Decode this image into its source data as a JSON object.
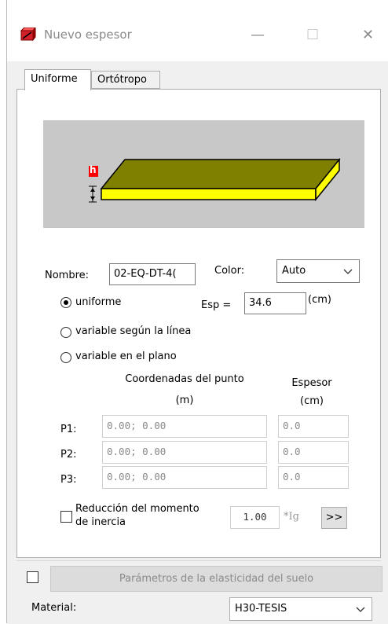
{
  "window": {
    "title": "Nuevo espesor",
    "min_glyph": "—",
    "max_glyph": "☐",
    "close_glyph": "✕"
  },
  "tabs": [
    {
      "label": "Uniforme",
      "active": true
    },
    {
      "label": "Ortótropo",
      "active": false
    }
  ],
  "preview": {
    "h_label": "h",
    "slab_color": "#808000",
    "edge_color": "#ffff00"
  },
  "form": {
    "nombre_label": "Nombre:",
    "nombre_value": "02-EQ-DT-4(",
    "color_label": "Color:",
    "color_value": "Auto",
    "radio_uniforme": "uniforme",
    "esp_label": "Esp =",
    "esp_value": "34.6",
    "esp_unit": "(cm)",
    "radio_linea": "variable según la línea",
    "radio_plano": "variable en el plano",
    "coord_header_1": "Coordenadas del punto",
    "coord_header_2": "(m)",
    "espesor_header_1": "Espesor",
    "espesor_header_2": "(cm)",
    "points": [
      {
        "label": "P1:",
        "coord": "0.00; 0.00",
        "thickness": "0.0"
      },
      {
        "label": "P2:",
        "coord": "0.00; 0.00",
        "thickness": "0.0"
      },
      {
        "label": "P3:",
        "coord": "0.00; 0.00",
        "thickness": "0.0"
      }
    ],
    "reduccion_line1": "Reducción del momento",
    "reduccion_line2": "de inercia",
    "reduccion_value": "1.00",
    "ig_label": "*Ig",
    "more_button": ">>"
  },
  "bottom": {
    "soil_button": "Parámetros de la elasticidad del suelo",
    "material_label": "Material:",
    "material_value": "H30-TESIS"
  }
}
